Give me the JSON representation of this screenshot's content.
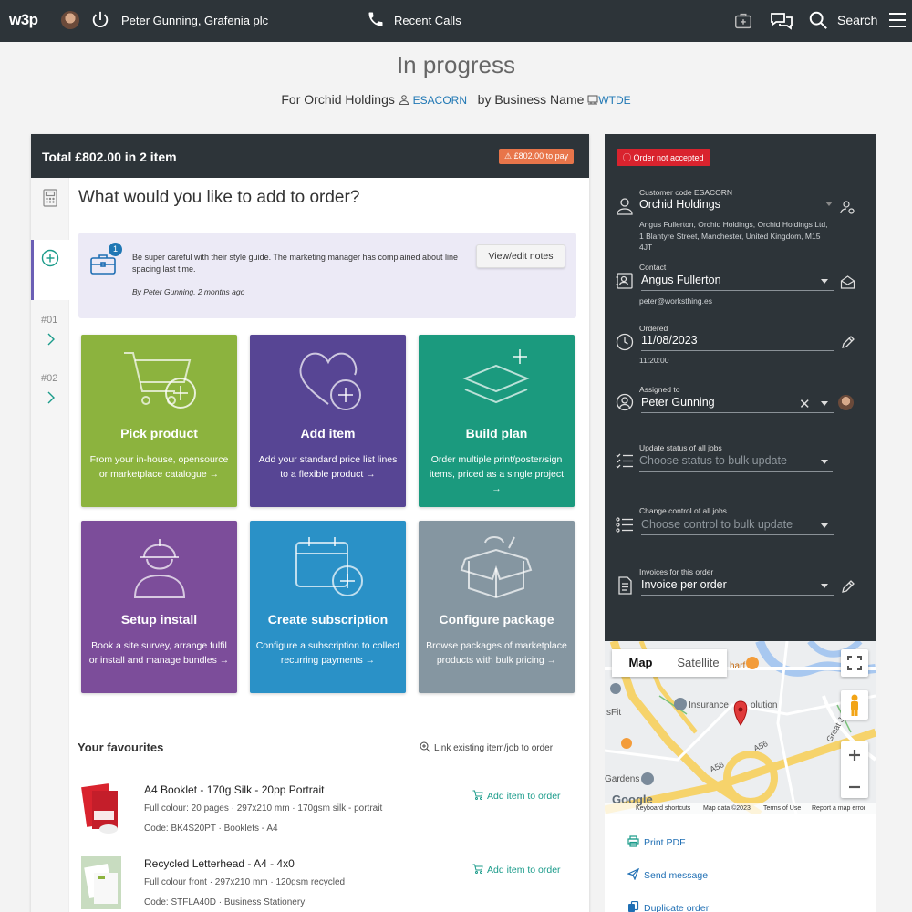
{
  "topbar": {
    "logo": "w3p",
    "user": "Peter Gunning, Grafenia plc",
    "recent_calls": "Recent Calls",
    "search": "Search"
  },
  "header": {
    "title": "In progress",
    "for_prefix": "For Orchid Holdings",
    "customer_code": "ESACORN",
    "by_prefix": "by Business Name",
    "business_code": "WTDE"
  },
  "order": {
    "total": "Total £802.00 in 2 item",
    "pay_badge": "£802.00 to pay",
    "rail": {
      "item1": "#01",
      "item2": "#02"
    },
    "question": "What would you like to add to order?",
    "notes": {
      "count": "1",
      "text": "Be super careful with their style guide. The marketing manager has complained about line spacing last time.",
      "author": "By Peter Gunning, 2 months ago",
      "button": "View/edit notes"
    },
    "tiles": [
      {
        "title": "Pick product",
        "desc": "From your in-house, opensource or marketplace catalogue",
        "color": "#8cb33e"
      },
      {
        "title": "Add item",
        "desc": "Add your standard price list lines to a flexible product",
        "color": "#574594"
      },
      {
        "title": "Build plan",
        "desc": "Order multiple print/poster/sign items, priced as a single project",
        "color": "#1b9a7e"
      },
      {
        "title": "Setup install",
        "desc": "Book a site survey, arrange fulfil or install and manage bundles",
        "color": "#7c4d9a"
      },
      {
        "title": "Create subscription",
        "desc": "Configure a subscription to collect recurring payments",
        "color": "#2a91c7"
      },
      {
        "title": "Configure package",
        "desc": "Browse packages of marketplace products with bulk pricing",
        "color": "#8596a1"
      }
    ],
    "favourites": {
      "title": "Your favourites",
      "link_existing": "Link existing item/job to order",
      "items": [
        {
          "name": "A4 Booklet - 170g Silk - 20pp Portrait",
          "desc": "Full colour: 20 pages · 297x210 mm · 170gsm silk - portrait",
          "code": "Code: BK4S20PT · Booklets - A4",
          "add": "Add item to order"
        },
        {
          "name": "Recycled Letterhead - A4 - 4x0",
          "desc": "Full colour front · 297x210 mm · 120gsm recycled",
          "code": "Code: STFLA40D · Business Stationery",
          "add": "Add item to order"
        }
      ]
    }
  },
  "panel": {
    "status": "Order not accepted",
    "customer": {
      "label": "Customer code ESACORN",
      "value": "Orchid Holdings",
      "address": "Angus Fullerton, Orchid Holdings, Orchid Holdings Ltd, 1 Blantyre Street, Manchester, United Kingdom, M15 4JT"
    },
    "contact": {
      "label": "Contact",
      "value": "Angus Fullerton",
      "email": "peter@worksthing.es"
    },
    "ordered": {
      "label": "Ordered",
      "date": "11/08/2023",
      "time": "11:20:00"
    },
    "assigned": {
      "label": "Assigned to",
      "value": "Peter Gunning"
    },
    "update_status": {
      "label": "Update status of all jobs",
      "placeholder": "Choose status to bulk update"
    },
    "change_control": {
      "label": "Change control of all jobs",
      "placeholder": "Choose control to bulk update"
    },
    "invoices": {
      "label": "Invoices for this order",
      "value": "Invoice per order"
    }
  },
  "map": {
    "tab_map": "Map",
    "tab_satellite": "Satellite",
    "poi_insurance": "Insurance",
    "poi_solution": "olution",
    "poi_fit": "sFit",
    "poi_gardens": "Gardens",
    "poi_wharf": "harf",
    "road_a56": "A56",
    "road_great": "Great J",
    "logo": "Google",
    "footer": {
      "shortcuts": "Keyboard shortcuts",
      "data": "Map data ©2023",
      "terms": "Terms of Use",
      "report": "Report a map error"
    }
  },
  "actions": {
    "print": "Print PDF",
    "send": "Send message",
    "duplicate": "Duplicate order"
  }
}
